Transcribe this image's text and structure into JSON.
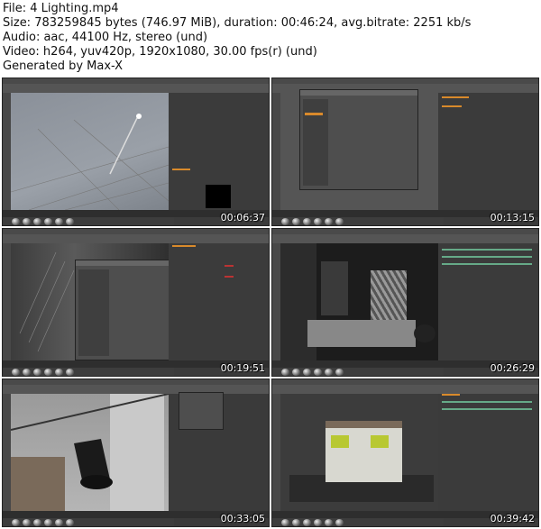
{
  "info": {
    "file": "File: 4 Lighting.mp4",
    "size": "Size: 783259845 bytes (746.97 MiB), duration: 00:46:24, avg.bitrate: 2251 kb/s",
    "audio": "Audio: aac, 44100 Hz, stereo (und)",
    "video": "Video: h264, yuv420p, 1920x1080, 30.00 fps(r) (und)",
    "generated": "Generated by Max-X"
  },
  "thumbnails": [
    {
      "timestamp": "00:06:37"
    },
    {
      "timestamp": "00:13:15"
    },
    {
      "timestamp": "00:19:51"
    },
    {
      "timestamp": "00:26:29"
    },
    {
      "timestamp": "00:33:05"
    },
    {
      "timestamp": "00:39:42"
    }
  ]
}
